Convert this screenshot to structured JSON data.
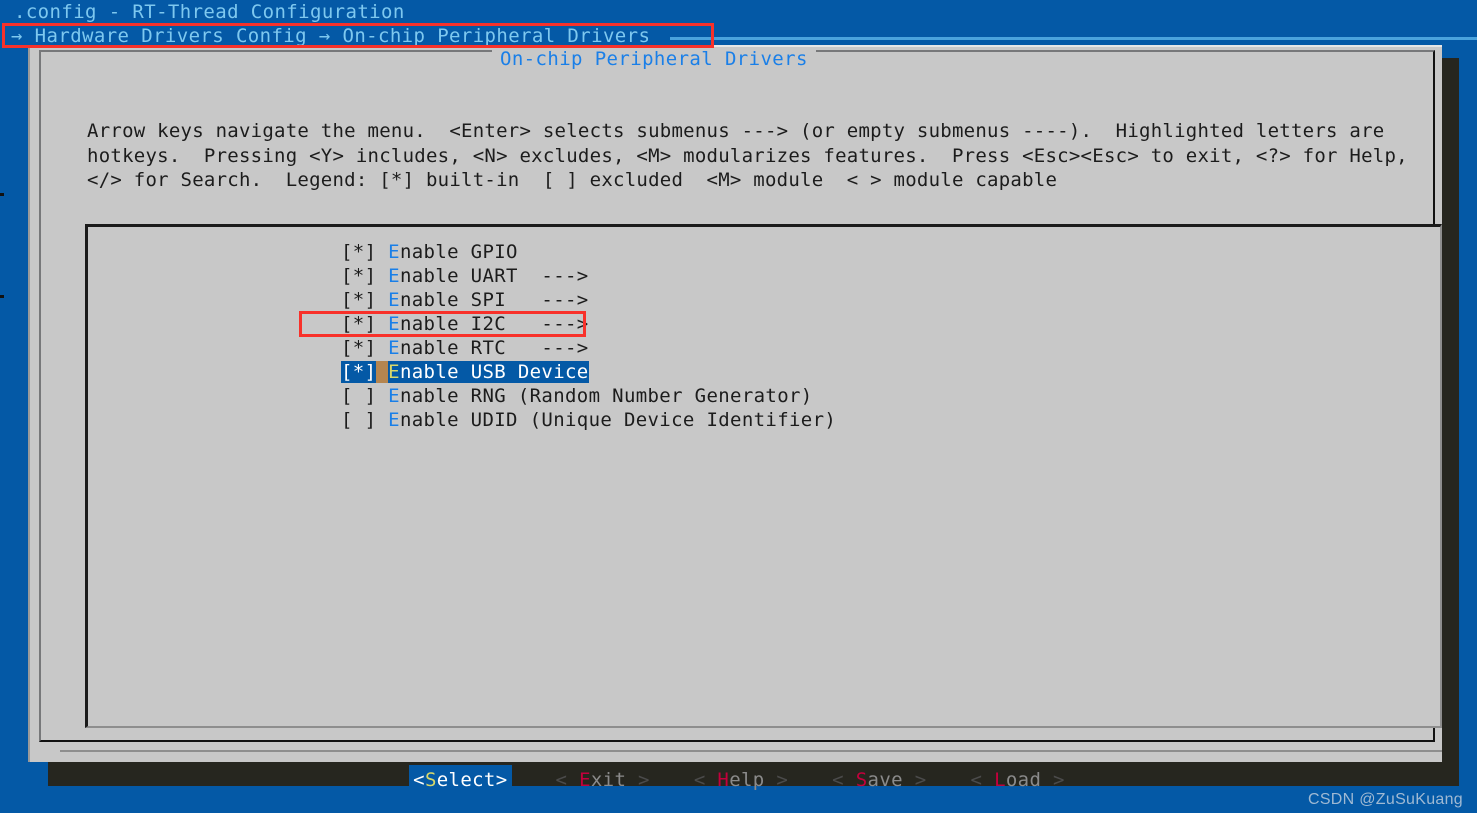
{
  "window": {
    "title": ".config - RT-Thread Configuration",
    "breadcrumb": "→ Hardware Drivers Config → On-chip Peripheral Drivers"
  },
  "frame": {
    "title": "On-chip Peripheral Drivers"
  },
  "help": {
    "line1": "Arrow keys navigate the menu.  <Enter> selects submenus ---> (or empty submenus ----).  Highlighted letters are",
    "line2": "hotkeys.  Pressing <Y> includes, <N> excludes, <M> modularizes features.  Press <Esc><Esc> to exit, <?> for Help,",
    "line3": "</> for Search.  Legend: [*] built-in  [ ] excluded  <M> module  < > module capable"
  },
  "menu": {
    "items": [
      {
        "mark": "[*]",
        "hotkey": "E",
        "label": "nable GPIO",
        "arrow": "",
        "selected": false
      },
      {
        "mark": "[*]",
        "hotkey": "E",
        "label": "nable UART",
        "arrow": "  --->",
        "selected": false
      },
      {
        "mark": "[*]",
        "hotkey": "E",
        "label": "nable SPI",
        "arrow": "   --->",
        "selected": false
      },
      {
        "mark": "[*]",
        "hotkey": "E",
        "label": "nable I2C",
        "arrow": "   --->",
        "selected": false
      },
      {
        "mark": "[*]",
        "hotkey": "E",
        "label": "nable RTC",
        "arrow": "   --->",
        "selected": false
      },
      {
        "mark": "[*]",
        "hotkey": "E",
        "label": "nable USB Device",
        "arrow": "",
        "selected": true
      },
      {
        "mark": "[ ]",
        "hotkey": "E",
        "label": "nable RNG (Random Number Generator)",
        "arrow": "",
        "selected": false
      },
      {
        "mark": "[ ]",
        "hotkey": "E",
        "label": "nable UDID (Unique Device Identifier)",
        "arrow": "",
        "selected": false
      }
    ]
  },
  "buttons": [
    {
      "name": "select",
      "open": "<",
      "hot": "S",
      "rest": "elect",
      "close": ">",
      "active": true
    },
    {
      "name": "exit",
      "open": "< ",
      "hot": "E",
      "rest": "xit",
      "close": " >",
      "active": false
    },
    {
      "name": "help",
      "open": "< ",
      "hot": "H",
      "rest": "elp",
      "close": " >",
      "active": false
    },
    {
      "name": "save",
      "open": "< ",
      "hot": "S",
      "rest": "ave",
      "close": " >",
      "active": false
    },
    {
      "name": "load",
      "open": "< ",
      "hot": "L",
      "rest": "oad",
      "close": " >",
      "active": false
    }
  ],
  "watermark": "CSDN @ZuSuKuang",
  "colors": {
    "terminal_blue": "#0459a6",
    "dialog_gray": "#c8c8c8",
    "hotkey_blue": "#1a7fe8",
    "hotkey_red": "#c3003c",
    "annotation_red": "#f8312a",
    "cursor_tan": "#b5854f",
    "title_cyan": "#7ec8ef"
  }
}
